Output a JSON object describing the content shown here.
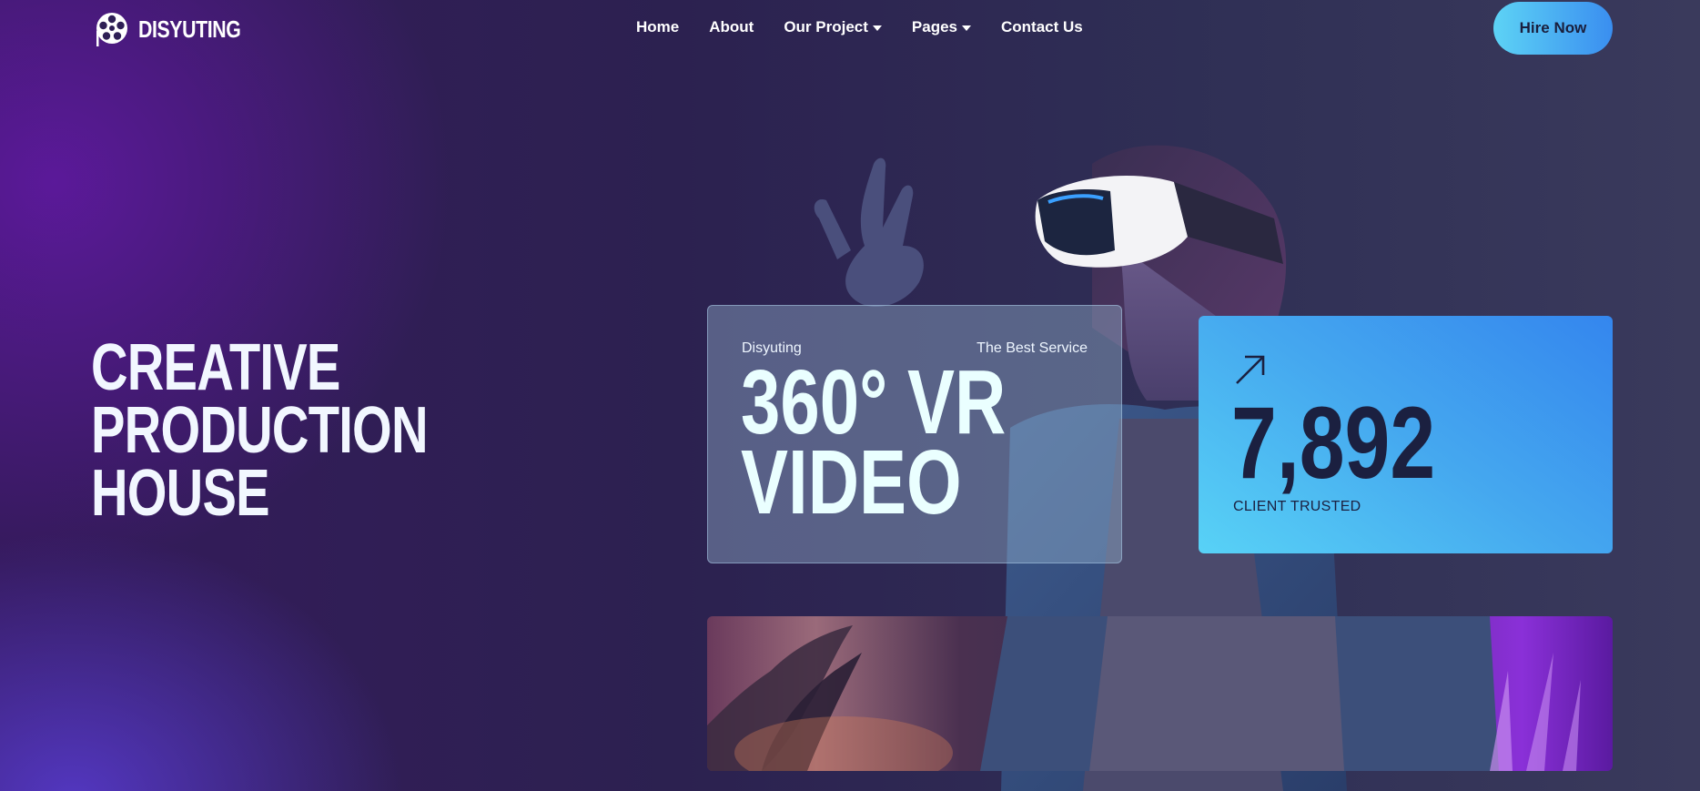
{
  "brand": {
    "name": "DISYUTING",
    "logo_icon": "film-reel-icon"
  },
  "nav": {
    "items": [
      {
        "label": "Home",
        "has_dropdown": false
      },
      {
        "label": "About",
        "has_dropdown": false
      },
      {
        "label": "Our Project",
        "has_dropdown": true
      },
      {
        "label": "Pages",
        "has_dropdown": true
      },
      {
        "label": "Contact Us",
        "has_dropdown": false
      }
    ],
    "cta_label": "Hire Now"
  },
  "hero": {
    "title_lines": [
      "CREATIVE",
      "PRODUCTION",
      "HOUSE"
    ]
  },
  "feature_card": {
    "brand": "Disyuting",
    "tagline": "The Best Service",
    "title_lines": [
      "360° VR",
      "VIDEO"
    ]
  },
  "stats_card": {
    "icon": "arrow-up-right-icon",
    "value": "7,892",
    "label": "CLIENT TRUSTED"
  },
  "colors": {
    "accent_start": "#5dd3f5",
    "accent_end": "#3a8ef0",
    "dark_text": "#1b2040"
  }
}
